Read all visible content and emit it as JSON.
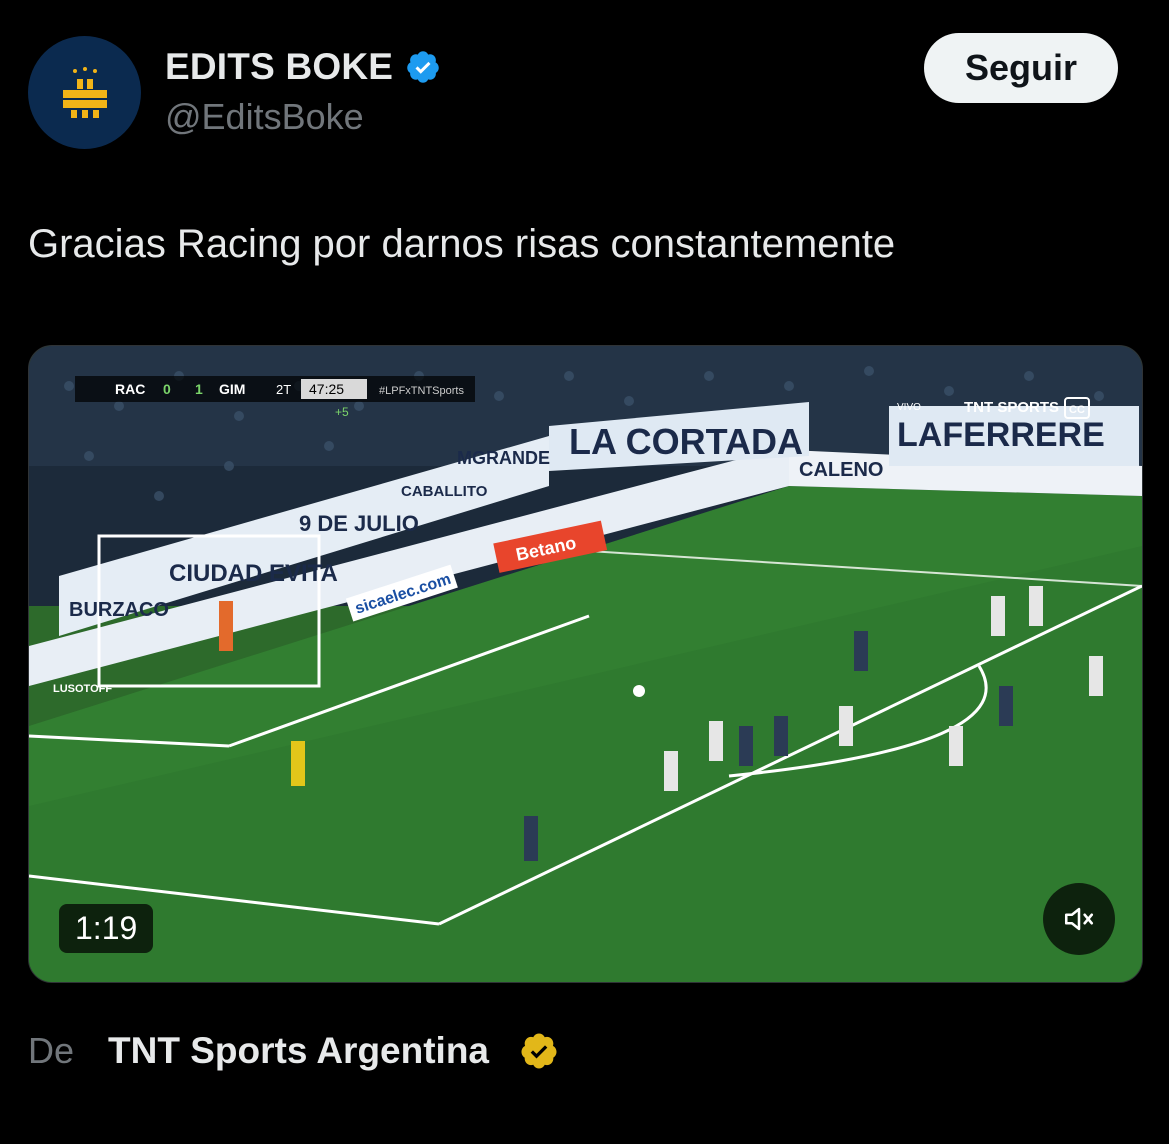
{
  "author": {
    "display_name": "EDITS BOKE",
    "handle": "@EditsBoke",
    "verified_color": "#1d9bf0"
  },
  "follow_button_label": "Seguir",
  "tweet": {
    "text": "Gracias Racing por darnos risas constantemente"
  },
  "video": {
    "duration": "1:19",
    "scoreboard": {
      "home": "RAC",
      "home_score": "0",
      "away_score": "1",
      "away": "GIM",
      "period": "2T",
      "clock": "47:25",
      "added_time": "+5",
      "hashtag": "#LPFxTNTSports"
    },
    "broadcaster": "TNT SPORTS",
    "live_label": "VIVO",
    "cc_label": "CC",
    "banners": [
      "LA CORTADA",
      "LAFERRERE",
      "BURZACO",
      "CIUDAD EVITA",
      "9 DE JULIO",
      "MGRANDE",
      "CABALLITO"
    ],
    "ads": [
      "CALENO",
      "Betano",
      "sicaelec.com",
      "LUSOTOFF"
    ],
    "mute_icon": "speaker-muted-icon"
  },
  "source": {
    "prefix": "De",
    "name": "TNT Sports Argentina",
    "verified_color": "#e2b719"
  }
}
